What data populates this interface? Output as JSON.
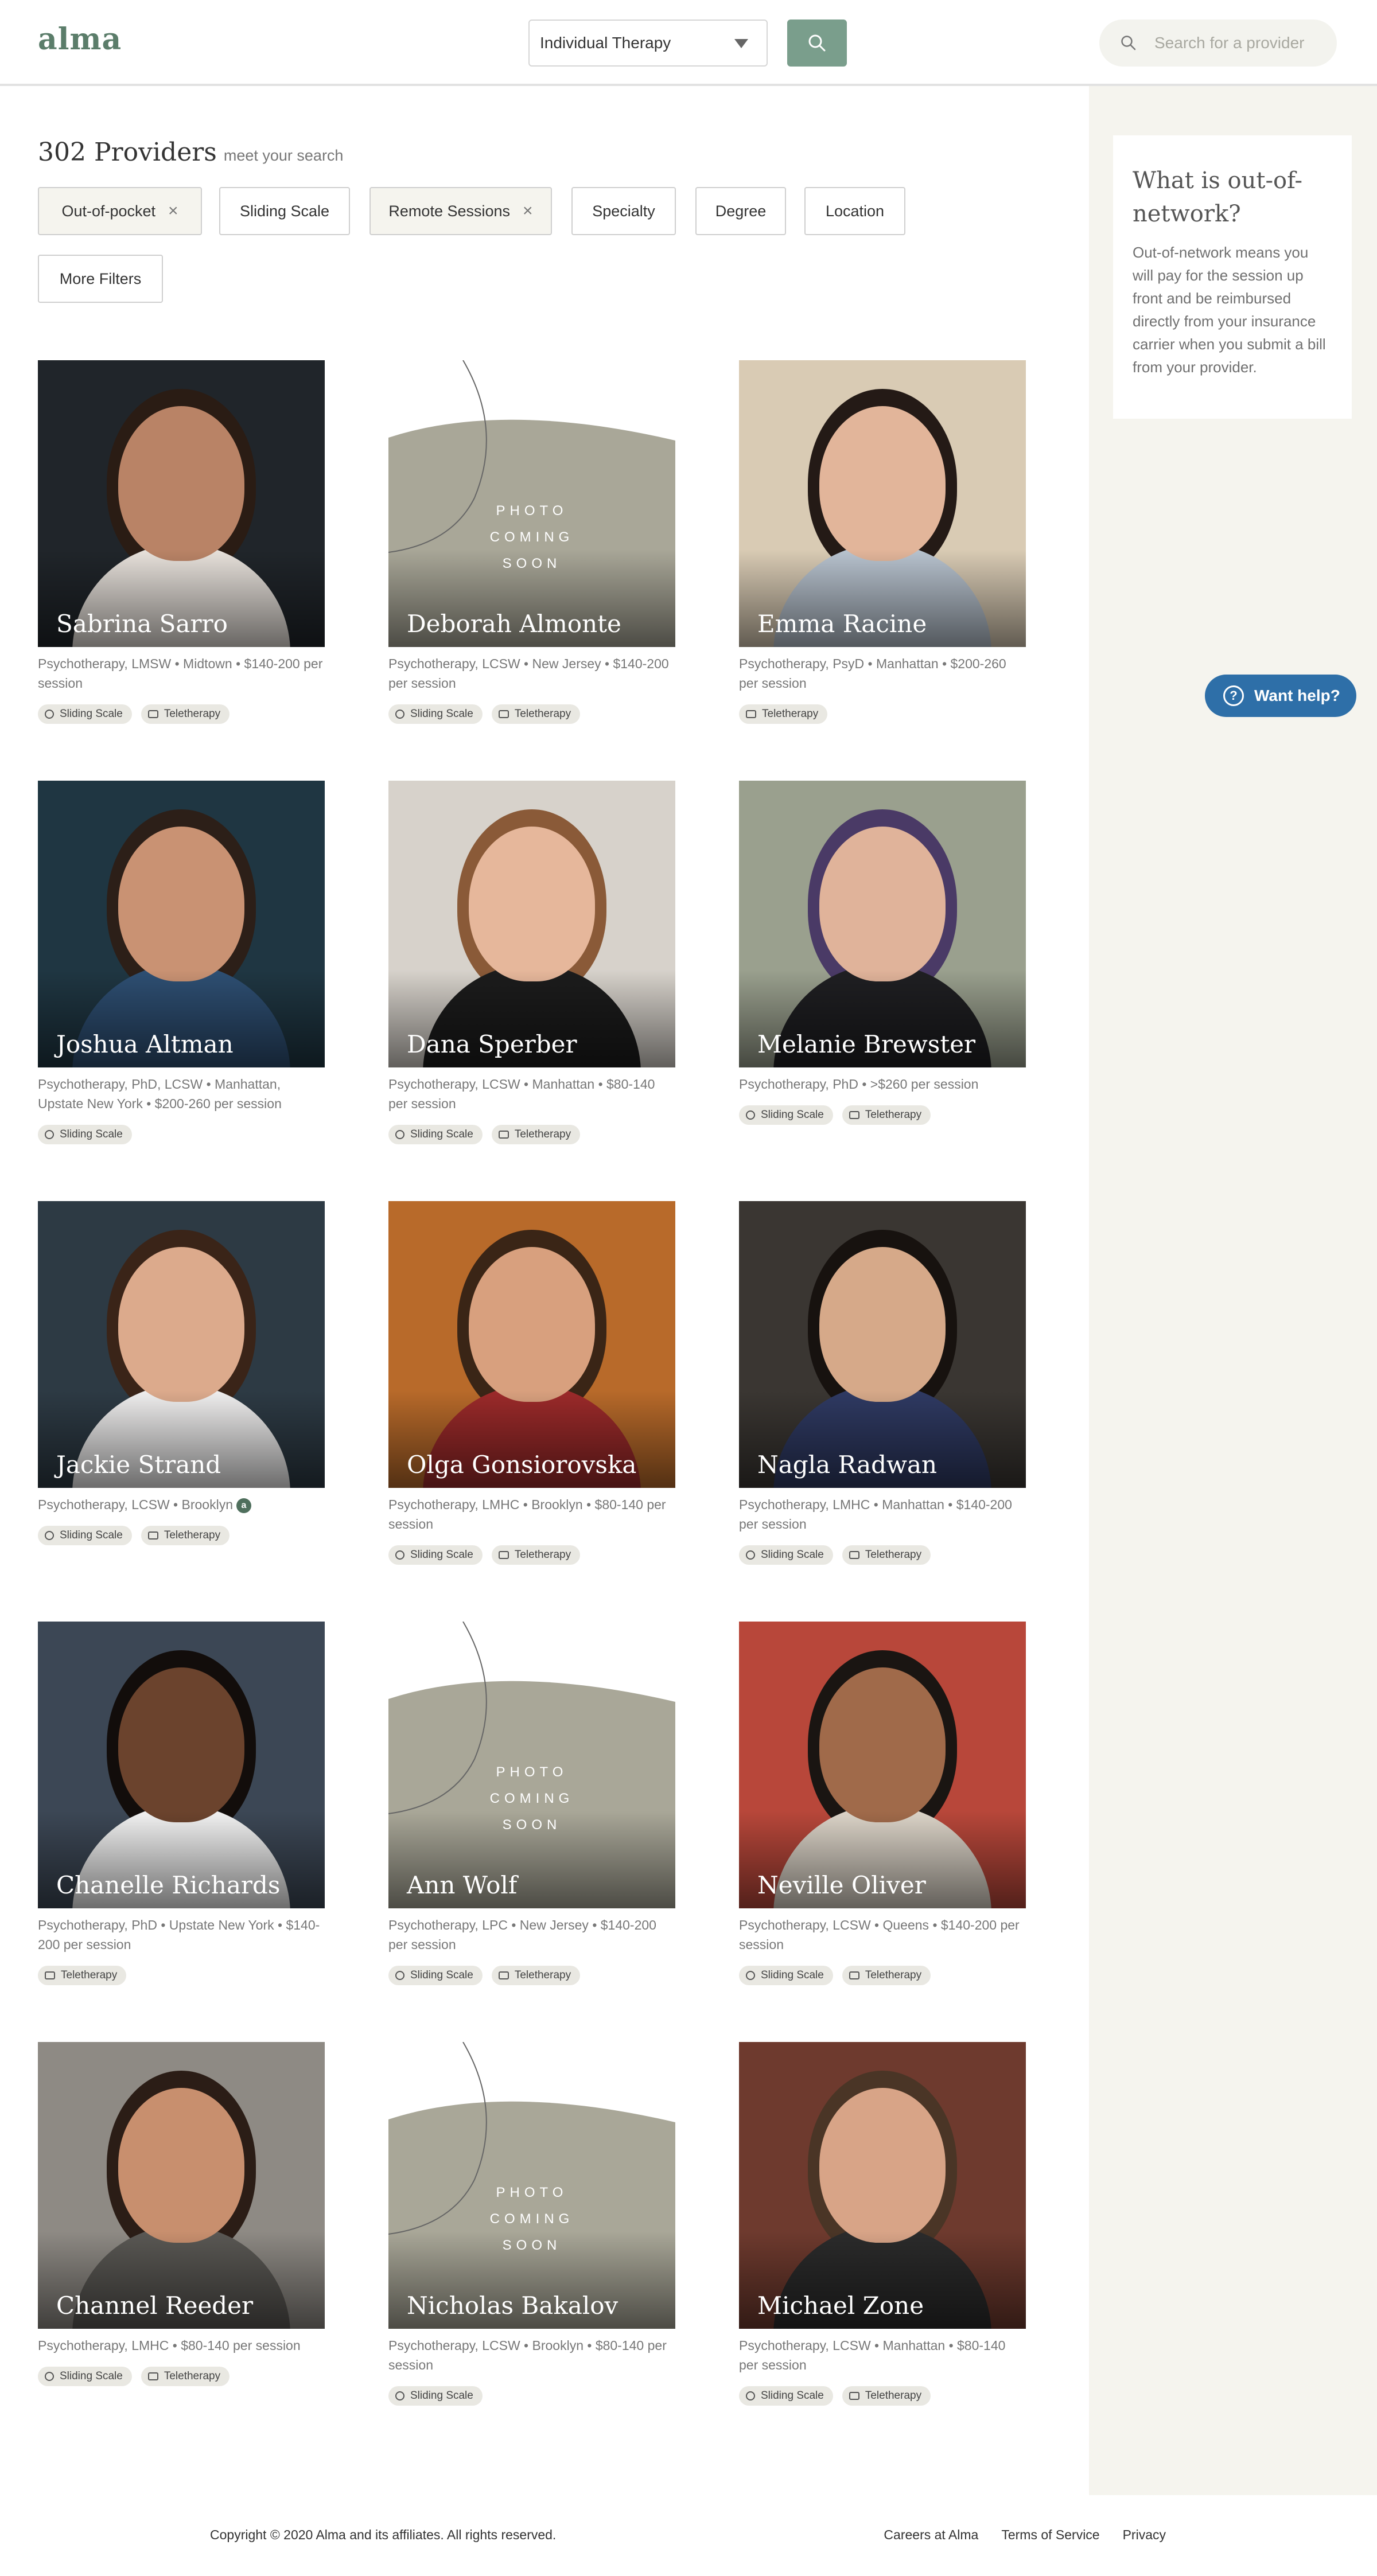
{
  "header": {
    "logo": "alma",
    "therapy_select": "Individual Therapy",
    "provider_search_placeholder": "Search for a provider"
  },
  "results": {
    "count": "302 Providers",
    "subtitle": "meet your search"
  },
  "filters": [
    {
      "label": "Out-of-pocket",
      "active": true
    },
    {
      "label": "Sliding Scale",
      "active": false
    },
    {
      "label": "Remote Sessions",
      "active": true
    },
    {
      "label": "Specialty",
      "active": false
    },
    {
      "label": "Degree",
      "active": false
    },
    {
      "label": "Location",
      "active": false
    },
    {
      "label": "More Filters",
      "active": false
    }
  ],
  "sidebar": {
    "title": "What is out-of-network?",
    "body": "Out-of-network means you will pay for the session up front and be reimbursed directly from your insurance carrier when you submit a bill from your provider.",
    "help_button": "Want help?"
  },
  "placeholder_text": [
    "PHOTO",
    "COMING",
    "SOON"
  ],
  "providers": [
    {
      "name": "Sabrina Sarro",
      "meta": "Psychotherapy, LMSW • Midtown • $140-200 per session",
      "tags": [
        "Sliding Scale",
        "Teletherapy"
      ],
      "photo": true,
      "bg": "#20252a",
      "skin": "#b98366",
      "hair": "#2a1c14",
      "shirt": "#e8e2dc"
    },
    {
      "name": "Deborah Almonte",
      "meta": "Psychotherapy, LCSW • New Jersey • $140-200 per session",
      "tags": [
        "Sliding Scale",
        "Teletherapy"
      ],
      "photo": false
    },
    {
      "name": "Emma Racine",
      "meta": "Psychotherapy, PsyD • Manhattan • $200-260 per session",
      "tags": [
        "Teletherapy"
      ],
      "photo": true,
      "bg": "#d9cbb4",
      "skin": "#e2b59a",
      "hair": "#241a16",
      "shirt": "#b8c3cf"
    },
    {
      "name": "Joshua Altman",
      "meta": "Psychotherapy, PhD, LCSW • Manhattan, Upstate New York • $200-260 per session",
      "tags": [
        "Sliding Scale"
      ],
      "photo": true,
      "bg": "#1f3642",
      "skin": "#c99273",
      "hair": "#2c1f18",
      "shirt": "#2e4f73"
    },
    {
      "name": "Dana Sperber",
      "meta": "Psychotherapy, LCSW • Manhattan • $80-140 per session",
      "tags": [
        "Sliding Scale",
        "Teletherapy"
      ],
      "photo": true,
      "bg": "#d7d2cb",
      "skin": "#e6b79b",
      "hair": "#8a5a38",
      "shirt": "#1c1c1c"
    },
    {
      "name": "Melanie Brewster",
      "meta": "Psychotherapy, PhD • >$260 per session",
      "tags": [
        "Sliding Scale",
        "Teletherapy"
      ],
      "photo": true,
      "bg": "#9aa08e",
      "skin": "#e0b39a",
      "hair": "#4a3a66",
      "shirt": "#1f1f22"
    },
    {
      "name": "Jackie Strand",
      "meta": "Psychotherapy, LCSW • Brooklyn",
      "verified": true,
      "tags": [
        "Sliding Scale",
        "Teletherapy"
      ],
      "photo": true,
      "bg": "#2d3a44",
      "skin": "#dcaa8c",
      "hair": "#3a2418",
      "shirt": "#f0efef"
    },
    {
      "name": "Olga Gonsiorovska",
      "meta": "Psychotherapy, LMHC • Brooklyn • $80-140 per session",
      "tags": [
        "Sliding Scale",
        "Teletherapy"
      ],
      "photo": true,
      "bg": "#b86a2a",
      "skin": "#d8a07e",
      "hair": "#3a2516",
      "shirt": "#9c2a2a"
    },
    {
      "name": "Nagla Radwan",
      "meta": "Psychotherapy, LMHC • Manhattan • $140-200 per session",
      "tags": [
        "Sliding Scale",
        "Teletherapy"
      ],
      "photo": true,
      "bg": "#3a3632",
      "skin": "#d6a989",
      "hair": "#17120f",
      "shirt": "#2f3a63"
    },
    {
      "name": "Chanelle Richards",
      "meta": "Psychotherapy, PhD • Upstate New York • $140-200 per session",
      "tags": [
        "Teletherapy"
      ],
      "photo": true,
      "bg": "#3c4755",
      "skin": "#6b432d",
      "hair": "#120d0b",
      "shirt": "#f2f2f2"
    },
    {
      "name": "Ann Wolf",
      "meta": "Psychotherapy, LPC • New Jersey • $140-200 per session",
      "tags": [
        "Sliding Scale",
        "Teletherapy"
      ],
      "photo": false
    },
    {
      "name": "Neville Oliver",
      "meta": "Psychotherapy, LCSW • Queens • $140-200 per session",
      "tags": [
        "Sliding Scale",
        "Teletherapy"
      ],
      "photo": true,
      "bg": "#b8473a",
      "skin": "#a06a4a",
      "hair": "#1a1512",
      "shirt": "#dcd4c8"
    },
    {
      "name": "Channel Reeder",
      "meta": "Psychotherapy, LMHC • $80-140 per session",
      "tags": [
        "Sliding Scale",
        "Teletherapy"
      ],
      "photo": true,
      "bg": "#8e8a84",
      "skin": "#c88f6e",
      "hair": "#2b1d16",
      "shirt": "#5a5854"
    },
    {
      "name": "Nicholas Bakalov",
      "meta": "Psychotherapy, LCSW • Brooklyn • $80-140 per session",
      "tags": [
        "Sliding Scale"
      ],
      "photo": false
    },
    {
      "name": "Michael Zone",
      "meta": "Psychotherapy, LCSW • Manhattan • $80-140 per session",
      "tags": [
        "Sliding Scale",
        "Teletherapy"
      ],
      "photo": true,
      "bg": "#6e3a2e",
      "skin": "#d8a487",
      "hair": "#4a3526",
      "shirt": "#2b2b2b"
    }
  ],
  "footer": {
    "copyright": "Copyright © 2020 Alma and its affiliates. All rights reserved.",
    "links": [
      "Careers at Alma",
      "Terms of Service",
      "Privacy"
    ]
  }
}
